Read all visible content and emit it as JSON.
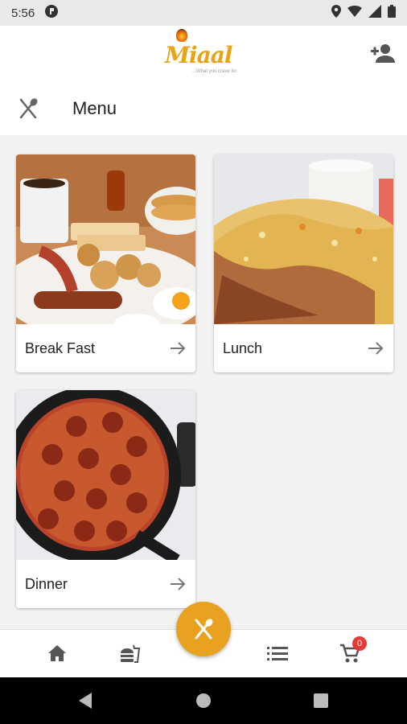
{
  "status_bar": {
    "time": "5:56"
  },
  "header": {
    "logo_text": "Miaal",
    "logo_tagline": "...What you crave for"
  },
  "menu_bar": {
    "title": "Menu"
  },
  "categories": [
    {
      "label": "Break Fast"
    },
    {
      "label": "Lunch"
    },
    {
      "label": "Dinner"
    }
  ],
  "bottom_nav": {
    "cart_count": "0"
  },
  "colors": {
    "accent": "#e8a21f",
    "badge": "#e53935"
  }
}
